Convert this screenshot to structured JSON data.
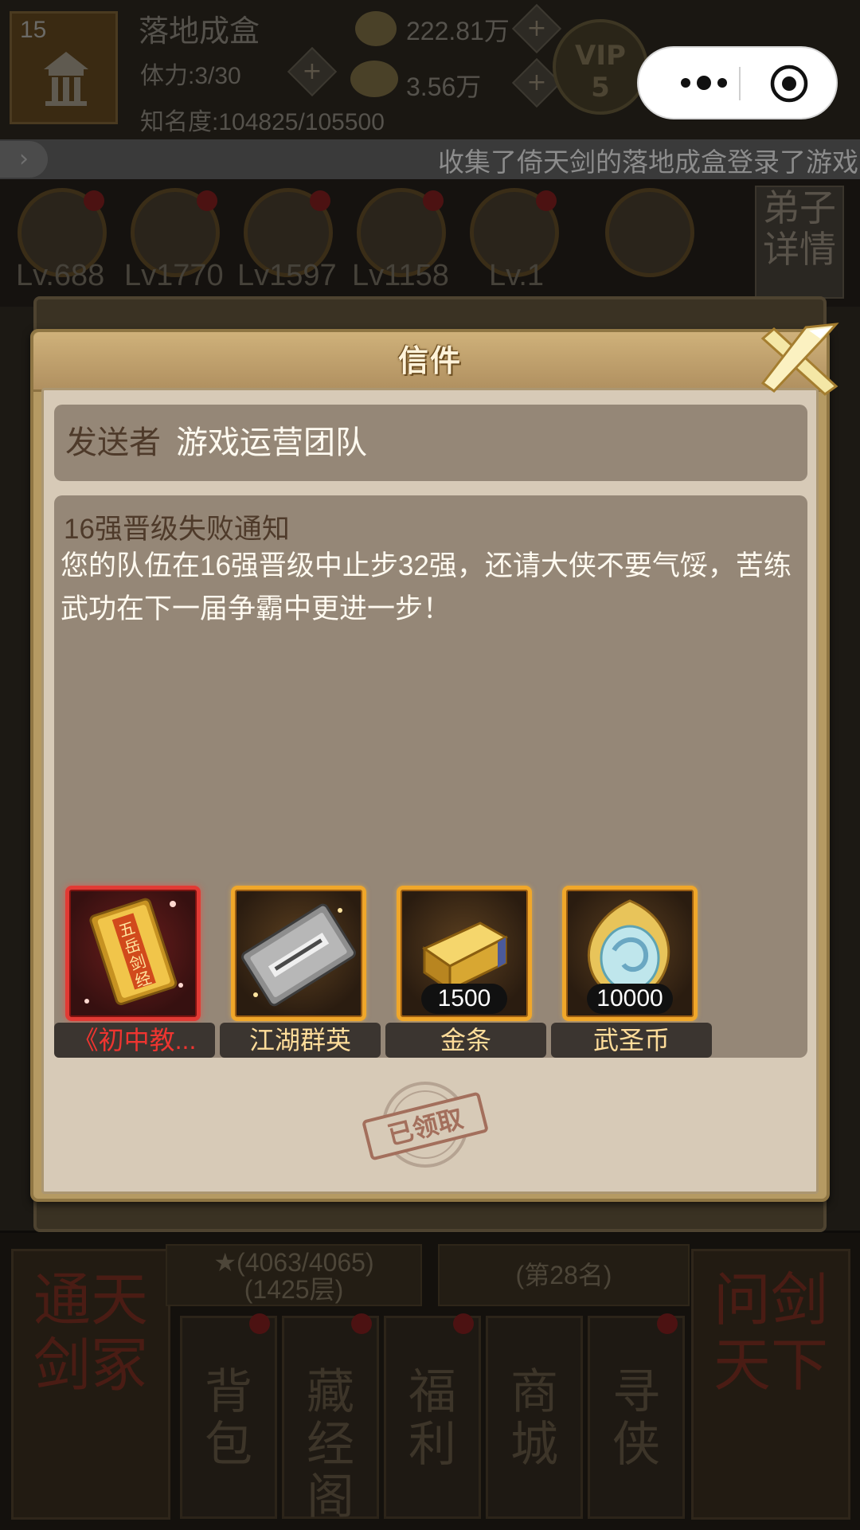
{
  "background": {
    "player": {
      "level": "15",
      "name": "落地成盒",
      "stamina": "体力:3/30",
      "fame": "知名度:104825/105500"
    },
    "currency": {
      "silver": "222.81万",
      "gold": "3.56万"
    },
    "vip": {
      "label": "VIP",
      "level": "5"
    },
    "marquee_text": "收集了倚天剑的落地成盒登录了游戏",
    "hero_levels": [
      "Lv.688",
      "Lv1770",
      "Lv1597",
      "Lv1158",
      "Lv.1"
    ],
    "side_tag": "弟子详情",
    "tower_info": "★(4063/4065)\n(1425层)",
    "rank_info": "(第28名)",
    "left_big_button": "通天剑冢",
    "right_big_button": "问剑天下",
    "nav": [
      "背包",
      "藏经阁",
      "福利",
      "商城",
      "寻侠"
    ]
  },
  "mini_program": {
    "more_icon": "more-dots-icon",
    "close_icon": "target-circle-icon"
  },
  "letter": {
    "title": "信件",
    "sender_label": "发送者",
    "sender_name": "游戏运营团队",
    "subject": "16强晋级失败通知",
    "body": "您的队伍在16强晋级中止步32强，还请大侠不要气馁，苦练武功在下一届争霸中更进一步！",
    "rewards": [
      {
        "name": "《初中教...",
        "quantity": "",
        "rarity": "red",
        "icon": "golden-scripture-book-icon",
        "icon_text": "五岳剑经"
      },
      {
        "name": "江湖群英",
        "quantity": "",
        "rarity": "gold",
        "icon": "silver-token-card-icon"
      },
      {
        "name": "金条",
        "quantity": "1500",
        "rarity": "gold",
        "icon": "gold-bar-icon"
      },
      {
        "name": "武圣币",
        "quantity": "10000",
        "rarity": "gold",
        "icon": "jade-coin-icon"
      }
    ],
    "status_stamp": "已领取",
    "colors": {
      "frame": "#b59a63",
      "panel": "#958777",
      "red_rarity": "#e13a34",
      "gold_rarity": "#f0a72a"
    }
  }
}
